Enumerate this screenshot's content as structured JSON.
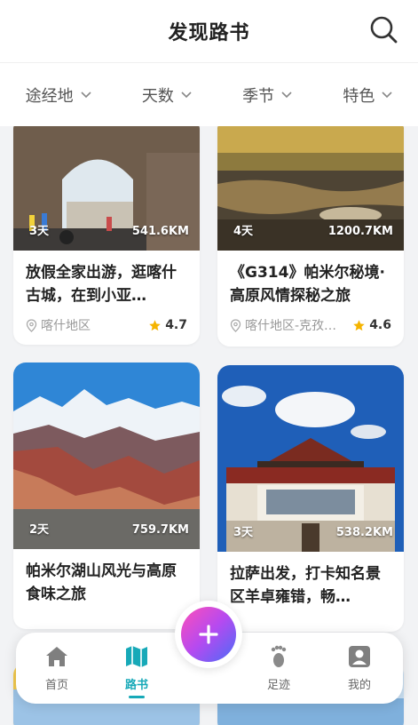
{
  "header": {
    "title": "发现路书",
    "search_icon": "search-icon"
  },
  "filters": [
    {
      "label": "途经地"
    },
    {
      "label": "天数"
    },
    {
      "label": "季节"
    },
    {
      "label": "特色"
    }
  ],
  "cards": [
    {
      "days": "3天",
      "distance": "541.6KM",
      "title": "放假全家出游，逛喀什古城，在到小亚…",
      "location": "喀什地区",
      "rating": "4.7"
    },
    {
      "days": "4天",
      "distance": "1200.7KM",
      "title": "《G314》帕米尔秘境·高原风情探秘之旅",
      "location": "喀什地区-克孜…",
      "rating": "4.6"
    },
    {
      "days": "2天",
      "distance": "759.7KM",
      "title": "帕米尔湖山风光与高原食味之旅"
    },
    {
      "days": "3天",
      "distance": "538.2KM",
      "title": "拉萨出发，打卡知名景区羊卓雍错，畅…"
    }
  ],
  "tabbar": {
    "home": "首页",
    "roadbook": "路书",
    "footprint": "足迹",
    "mine": "我的"
  },
  "colors": {
    "accent": "#17a9b8",
    "star": "#f5b400"
  }
}
